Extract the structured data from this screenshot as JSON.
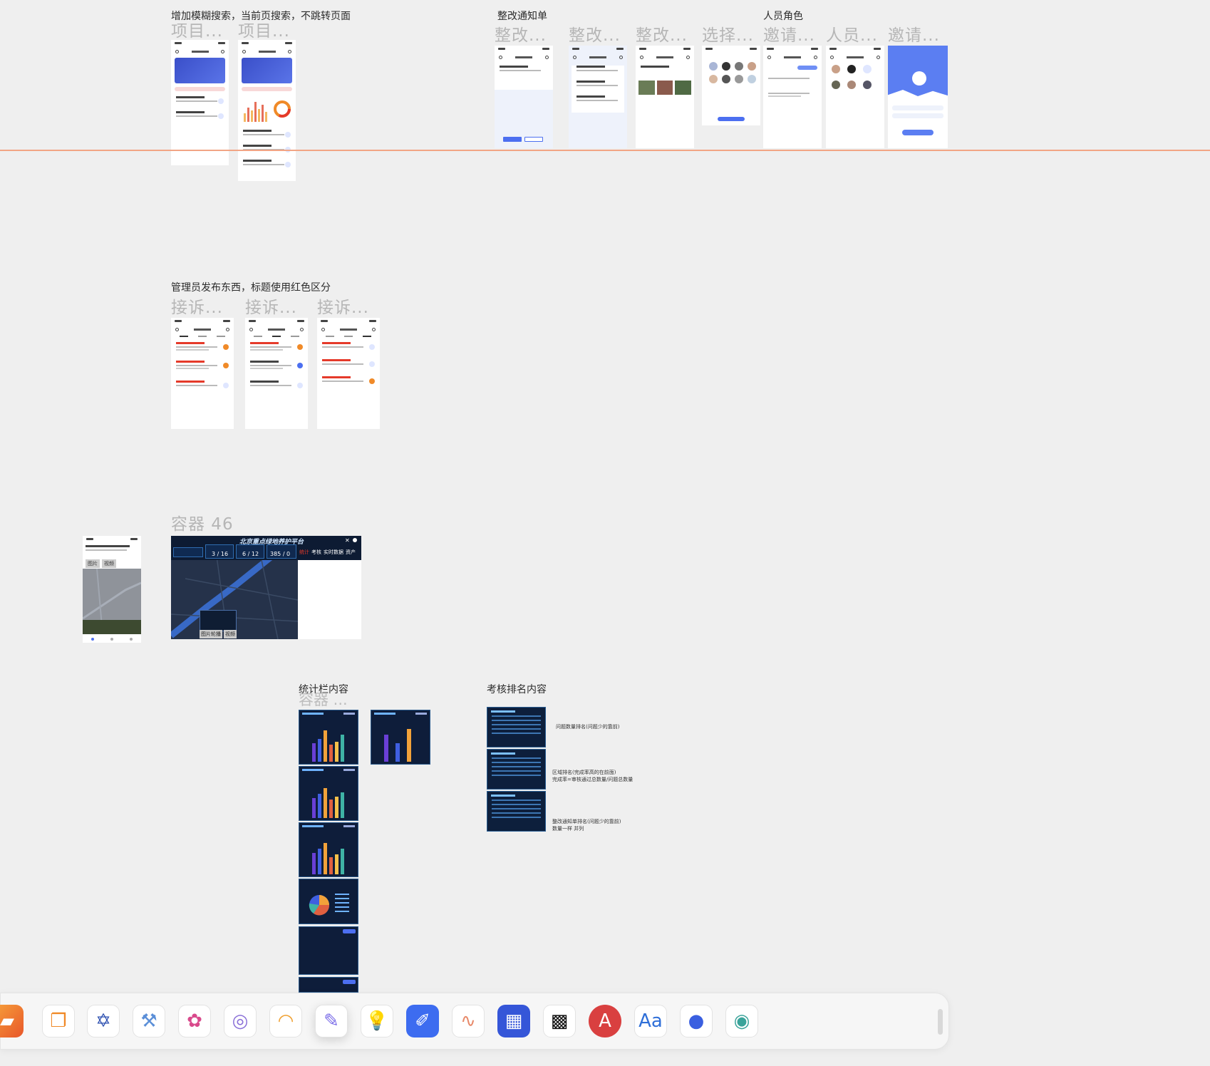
{
  "notes": {
    "fuzzy_search": "增加模糊搜索，当前页搜索，不跳转页面",
    "rectify_notice": "整改通知单",
    "person_role": "人员角色",
    "admin_publish": "管理员发布东西，标题使用红色区分",
    "stats_content": "统计栏内容",
    "rank_content": "考核排名内容",
    "rank_desc_1": "问题数量排名(问题少的靠前)",
    "rank_desc_2a": "区域排名(完成率高的在前面)",
    "rank_desc_2b": "完成率=审核通过总数量/问题总数量",
    "rank_desc_3a": "整改通知单排名(问题少的靠前)",
    "rank_desc_3b": "数量一样 并列"
  },
  "frame_labels": {
    "row1": [
      "项目...",
      "项目...",
      "整改...",
      "整改...",
      "整改...",
      "选择...",
      "邀请...",
      "人员...",
      "邀请..."
    ],
    "row2": [
      "接诉...",
      "接诉...",
      "接诉..."
    ],
    "container46": "容器 46",
    "container_stats": "容器 ..."
  },
  "dashboard": {
    "title": "北京重点绿地养护平台",
    "stats": [
      "3 / 16",
      "6 / 12",
      "385 / 0"
    ],
    "tabs": [
      "统计",
      "考核",
      "实时数据",
      "资产"
    ],
    "map_buttons": [
      "图片轮播",
      "视频"
    ]
  },
  "side_phone": {
    "buttons": [
      "图片",
      "视频"
    ]
  },
  "dock_apps": [
    "maps-app",
    "layers-app",
    "star-of-david-app",
    "xcode-tools-app",
    "pinwheel-photos-app",
    "spiral-app",
    "rainbow-app",
    "pencil-app",
    "lightbulb-app",
    "edit-pencil-app",
    "ink-signature-app",
    "table-app",
    "qr-code-app",
    "text-size-app",
    "dictionary-app",
    "blue-circle-app",
    "frog-app"
  ],
  "colors": {
    "guide_line": "#f2a585",
    "brand_blue": "#4c6ff0",
    "dark_panel": "#0e1d3a",
    "alert_red": "#e53a2a",
    "accent_orange": "#f08a28"
  }
}
